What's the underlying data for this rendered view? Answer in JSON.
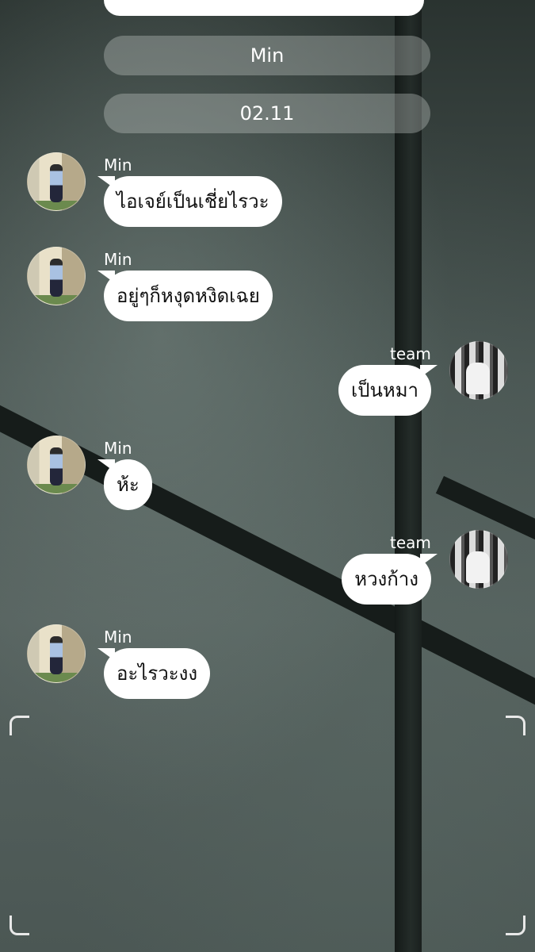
{
  "header": {
    "contact_name": "Min",
    "date": "02.11"
  },
  "messages": [
    {
      "sender": "Min",
      "side": "left",
      "text": "ไอเจย์เป็นเชี่ยไรวะ"
    },
    {
      "sender": "Min",
      "side": "left",
      "text": "อยู่ๆก็หงุดหงิดเฉย"
    },
    {
      "sender": "team",
      "side": "right",
      "text": "เป็นหมา"
    },
    {
      "sender": "Min",
      "side": "left",
      "text": "ห้ะ"
    },
    {
      "sender": "team",
      "side": "right",
      "text": "หวงก้าง"
    },
    {
      "sender": "Min",
      "side": "left",
      "text": "อะไรวะงง"
    }
  ],
  "colors": {
    "bubble": "#ffffff",
    "pill": "rgba(200,205,203,0.35)",
    "text_on_bg": "#ffffff"
  }
}
